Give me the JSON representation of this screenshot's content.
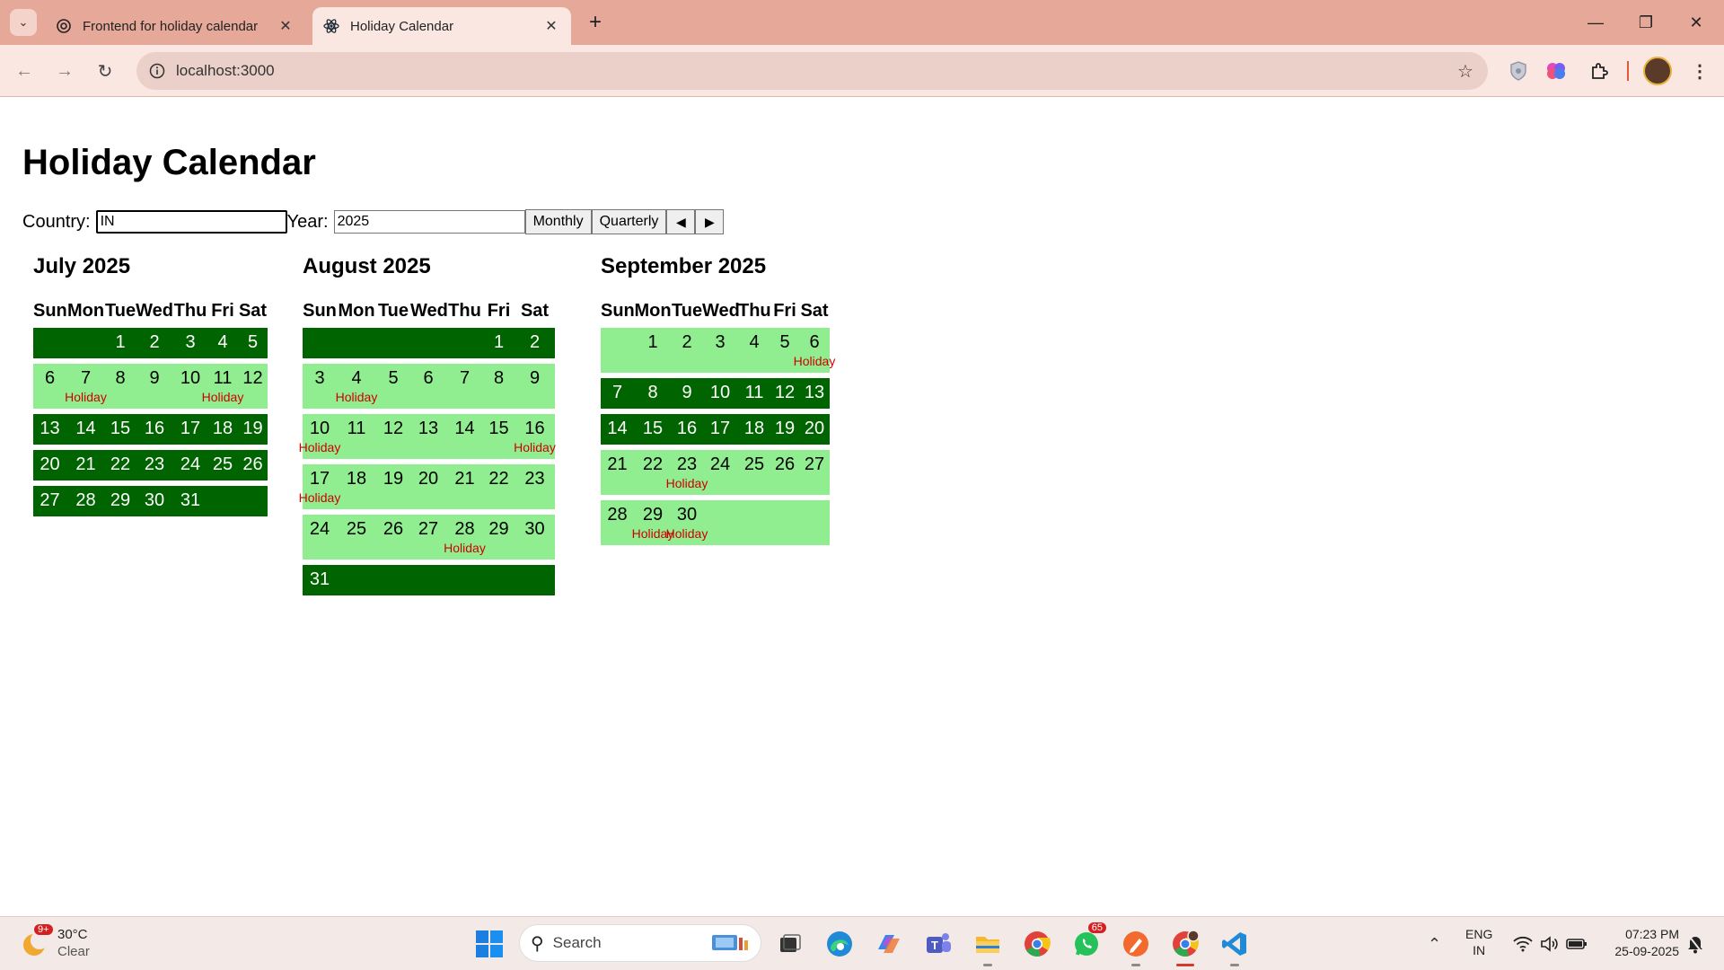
{
  "browser": {
    "tabs": [
      {
        "title": "Frontend for holiday calendar",
        "icon": "openai-icon",
        "active": false
      },
      {
        "title": "Holiday Calendar",
        "icon": "react-icon",
        "active": true
      }
    ],
    "url": "localhost:3000"
  },
  "page": {
    "title": "Holiday Calendar",
    "country_label": "Country:",
    "country_value": "IN",
    "year_label": "Year:",
    "year_value": "2025",
    "monthly_label": "Monthly",
    "quarterly_label": "Quarterly",
    "prev_label": "◀",
    "next_label": "▶",
    "colors": {
      "week_dark": "#006400",
      "week_light": "#90ee90",
      "holiday_text": "#d00000"
    },
    "months": [
      {
        "title": "July 2025",
        "weekdays": [
          "Sun",
          "Mon",
          "Tue",
          "Wed",
          "Thu",
          "Fri",
          "Sat"
        ],
        "weeks": [
          {
            "style": "dark",
            "days": [
              {
                "n": ""
              },
              {
                "n": ""
              },
              {
                "n": "1"
              },
              {
                "n": "2"
              },
              {
                "n": "3"
              },
              {
                "n": "4"
              },
              {
                "n": "5"
              }
            ]
          },
          {
            "style": "light",
            "days": [
              {
                "n": "6"
              },
              {
                "n": "7",
                "h": "Holiday"
              },
              {
                "n": "8"
              },
              {
                "n": "9"
              },
              {
                "n": "10"
              },
              {
                "n": "11",
                "h": "Holiday"
              },
              {
                "n": "12"
              }
            ]
          },
          {
            "style": "dark",
            "days": [
              {
                "n": "13"
              },
              {
                "n": "14"
              },
              {
                "n": "15"
              },
              {
                "n": "16"
              },
              {
                "n": "17"
              },
              {
                "n": "18"
              },
              {
                "n": "19"
              }
            ]
          },
          {
            "style": "dark",
            "days": [
              {
                "n": "20"
              },
              {
                "n": "21"
              },
              {
                "n": "22"
              },
              {
                "n": "23"
              },
              {
                "n": "24"
              },
              {
                "n": "25"
              },
              {
                "n": "26"
              }
            ]
          },
          {
            "style": "dark",
            "days": [
              {
                "n": "27"
              },
              {
                "n": "28"
              },
              {
                "n": "29"
              },
              {
                "n": "30"
              },
              {
                "n": "31"
              },
              {
                "n": ""
              },
              {
                "n": ""
              }
            ]
          }
        ]
      },
      {
        "title": "August 2025",
        "weekdays": [
          "Sun",
          "Mon",
          "Tue",
          "Wed",
          "Thu",
          "Fri",
          "Sat"
        ],
        "weeks": [
          {
            "style": "dark",
            "days": [
              {
                "n": ""
              },
              {
                "n": ""
              },
              {
                "n": ""
              },
              {
                "n": ""
              },
              {
                "n": ""
              },
              {
                "n": "1"
              },
              {
                "n": "2"
              }
            ]
          },
          {
            "style": "light",
            "days": [
              {
                "n": "3"
              },
              {
                "n": "4",
                "h": "Holiday"
              },
              {
                "n": "5"
              },
              {
                "n": "6"
              },
              {
                "n": "7"
              },
              {
                "n": "8"
              },
              {
                "n": "9"
              }
            ]
          },
          {
            "style": "light",
            "days": [
              {
                "n": "10",
                "h": "Holiday"
              },
              {
                "n": "11"
              },
              {
                "n": "12"
              },
              {
                "n": "13"
              },
              {
                "n": "14"
              },
              {
                "n": "15"
              },
              {
                "n": "16",
                "h": "Holiday"
              }
            ]
          },
          {
            "style": "light",
            "days": [
              {
                "n": "17",
                "h": "Holiday"
              },
              {
                "n": "18"
              },
              {
                "n": "19"
              },
              {
                "n": "20"
              },
              {
                "n": "21"
              },
              {
                "n": "22"
              },
              {
                "n": "23"
              }
            ]
          },
          {
            "style": "light",
            "days": [
              {
                "n": "24"
              },
              {
                "n": "25"
              },
              {
                "n": "26"
              },
              {
                "n": "27"
              },
              {
                "n": "28",
                "h": "Holiday"
              },
              {
                "n": "29"
              },
              {
                "n": "30"
              }
            ]
          },
          {
            "style": "dark",
            "days": [
              {
                "n": "31"
              },
              {
                "n": ""
              },
              {
                "n": ""
              },
              {
                "n": ""
              },
              {
                "n": ""
              },
              {
                "n": ""
              },
              {
                "n": ""
              }
            ]
          }
        ]
      },
      {
        "title": "September 2025",
        "weekdays": [
          "Sun",
          "Mon",
          "Tue",
          "Wed",
          "Thu",
          "Fri",
          "Sat"
        ],
        "weeks": [
          {
            "style": "light",
            "days": [
              {
                "n": ""
              },
              {
                "n": "1"
              },
              {
                "n": "2"
              },
              {
                "n": "3"
              },
              {
                "n": "4"
              },
              {
                "n": "5"
              },
              {
                "n": "6",
                "h": "Holiday"
              }
            ]
          },
          {
            "style": "dark",
            "days": [
              {
                "n": "7"
              },
              {
                "n": "8"
              },
              {
                "n": "9"
              },
              {
                "n": "10"
              },
              {
                "n": "11"
              },
              {
                "n": "12"
              },
              {
                "n": "13"
              }
            ]
          },
          {
            "style": "dark",
            "days": [
              {
                "n": "14"
              },
              {
                "n": "15"
              },
              {
                "n": "16"
              },
              {
                "n": "17"
              },
              {
                "n": "18"
              },
              {
                "n": "19"
              },
              {
                "n": "20"
              }
            ]
          },
          {
            "style": "light",
            "days": [
              {
                "n": "21"
              },
              {
                "n": "22"
              },
              {
                "n": "23",
                "h": "Holiday"
              },
              {
                "n": "24"
              },
              {
                "n": "25"
              },
              {
                "n": "26"
              },
              {
                "n": "27"
              }
            ]
          },
          {
            "style": "light",
            "days": [
              {
                "n": "28"
              },
              {
                "n": "29",
                "h": "Holiday"
              },
              {
                "n": "30",
                "h": "Holiday"
              },
              {
                "n": ""
              },
              {
                "n": ""
              },
              {
                "n": ""
              },
              {
                "n": ""
              }
            ]
          }
        ]
      }
    ]
  },
  "taskbar": {
    "weather_temp": "30°C",
    "weather_cond": "Clear",
    "weather_badge": "9+",
    "search_label": "Search",
    "apps": [
      "file-explorer-icon",
      "edge-icon",
      "copilot-icon",
      "teams-icon",
      "folder-icon",
      "chrome-icon",
      "whatsapp-icon",
      "pen-icon",
      "chrome-profile-icon",
      "vscode-icon"
    ],
    "whatsapp_badge": "65",
    "lang_line1": "ENG",
    "lang_line2": "IN",
    "time": "07:23 PM",
    "date": "25-09-2025"
  }
}
